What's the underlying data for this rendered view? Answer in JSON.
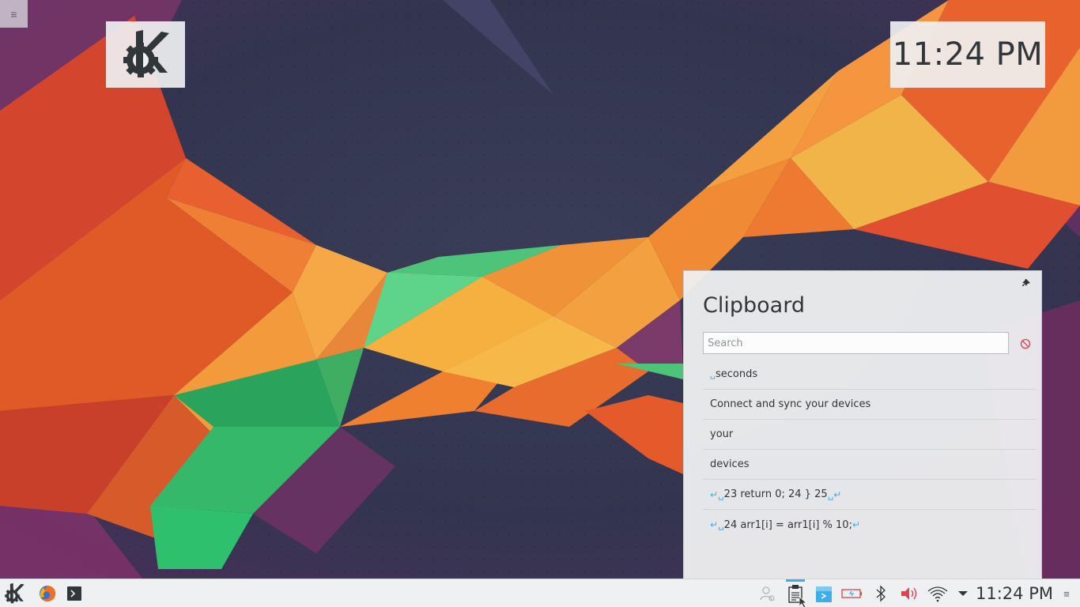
{
  "desktop": {
    "toolbox_icon": "hamburger-menu-icon",
    "logo_widget_icon": "kde-logo-icon",
    "clock_time": "11:24 PM"
  },
  "clipboard": {
    "title": "Clipboard",
    "search_placeholder": "Search",
    "pin_icon": "pin-icon",
    "clear_icon": "clear-history-icon",
    "items": [
      {
        "prefix": "␣",
        "text": "seconds",
        "suffix": ""
      },
      {
        "prefix": "",
        "text": "Connect and sync your devices",
        "suffix": ""
      },
      {
        "prefix": "",
        "text": "your",
        "suffix": ""
      },
      {
        "prefix": "",
        "text": "devices",
        "suffix": ""
      },
      {
        "prefix": "↵␣",
        "text": "23 return 0; 24 } 25",
        "suffix": "␣↵"
      },
      {
        "prefix": "↵␣",
        "text": "24 arr1[i] = arr1[i] % 10;",
        "suffix": "↵"
      }
    ]
  },
  "taskbar": {
    "launchers": [
      "kde-application-launcher-icon",
      "firefox-icon",
      "konsole-icon"
    ],
    "tray_icons": [
      "user-switcher-icon",
      "clipboard-icon",
      "kdeconnect-icon",
      "battery-icon",
      "bluetooth-icon",
      "volume-icon",
      "wifi-icon",
      "expand-tray-arrow-icon"
    ],
    "clock_time": "11:24 PM",
    "accent_color": "#3daee9"
  }
}
